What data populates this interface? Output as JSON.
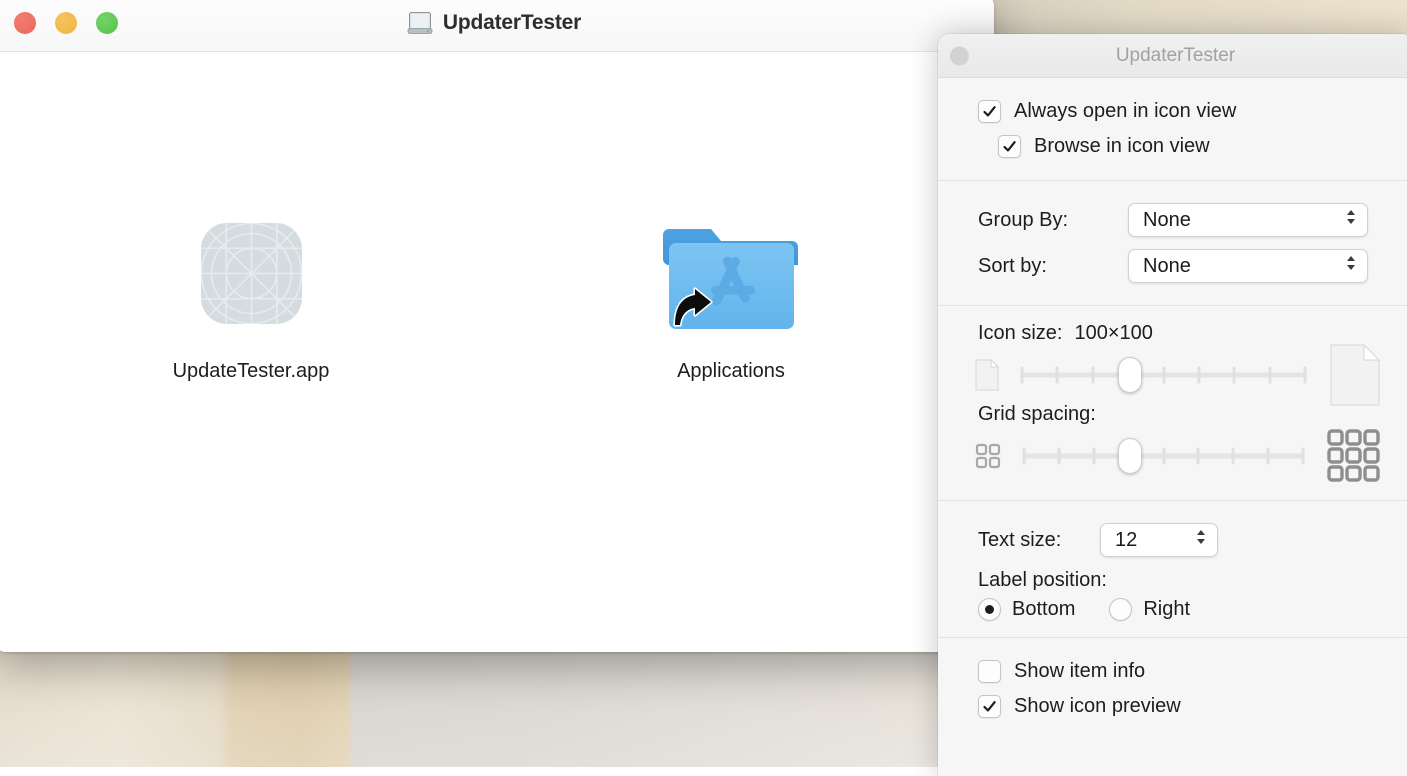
{
  "desktop": {
    "wallpaper_colors": [
      "#cfc1a6",
      "#c3a468",
      "#bdb6ab",
      "#ece2cd"
    ]
  },
  "finder_window": {
    "title": "UpdaterTester",
    "title_icon": "external-drive-icon",
    "traffic_lights": [
      {
        "name": "close",
        "color": "#e8685c"
      },
      {
        "name": "minimize",
        "color": "#eeb43f"
      },
      {
        "name": "maximize",
        "color": "#57c44c"
      }
    ],
    "items": [
      {
        "label": "UpdateTester.app",
        "icon": "generic-app-icon"
      },
      {
        "label": "Applications",
        "icon": "applications-folder-alias-icon"
      }
    ]
  },
  "inspector": {
    "title": "UpdaterTester",
    "close_button": "close-button",
    "view_options": [
      {
        "label": "Always open in icon view",
        "checked": true
      },
      {
        "label": "Browse in icon view",
        "checked": true,
        "indent": true
      }
    ],
    "group_by": {
      "label": "Group By:",
      "value": "None"
    },
    "sort_by": {
      "label": "Sort by:",
      "value": "None"
    },
    "icon_size": {
      "label": "Icon size:",
      "value": "100×100",
      "slider_percent": 38,
      "ticks": 9,
      "left_icon": "small-document-icon",
      "right_icon": "large-document-icon"
    },
    "grid_spacing": {
      "label": "Grid spacing:",
      "slider_percent": 38,
      "ticks": 9,
      "left_icon": "grid-small-icon",
      "right_icon": "grid-large-icon"
    },
    "text_size": {
      "label": "Text size:",
      "value": "12"
    },
    "label_position": {
      "label": "Label position:",
      "options": [
        {
          "label": "Bottom",
          "selected": true
        },
        {
          "label": "Right",
          "selected": false
        }
      ]
    },
    "display_options": [
      {
        "label": "Show item info",
        "checked": false
      },
      {
        "label": "Show icon preview",
        "checked": true
      }
    ]
  }
}
